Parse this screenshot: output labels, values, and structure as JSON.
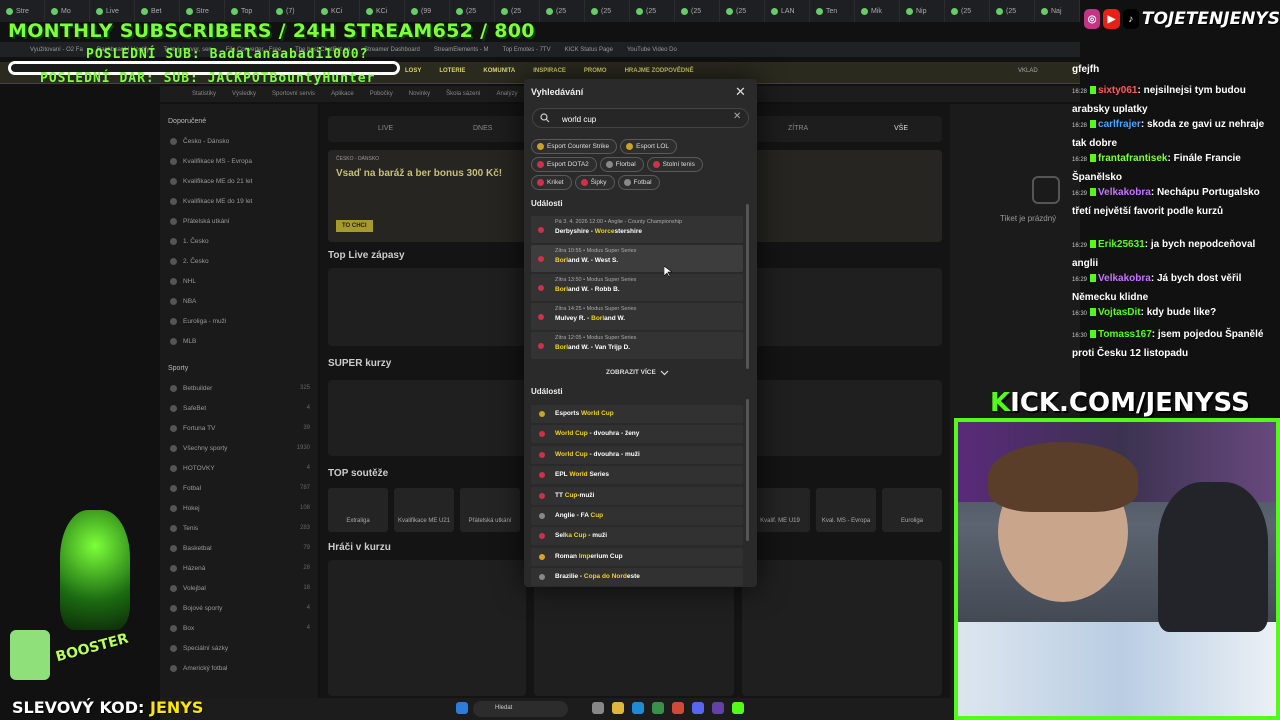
{
  "browser": {
    "tabs": [
      "Stre",
      "Mo",
      "Live",
      "Bet",
      "Stre",
      "Top",
      "(7)",
      "KCi",
      "KCi",
      "(99",
      "(25",
      "(25",
      "(25",
      "(25",
      "(25",
      "(25",
      "(25",
      "LAN",
      "Ten",
      "Mik",
      "Nip",
      "(25",
      "(25",
      "Naj",
      "(25",
      "(25"
    ],
    "bookmarks": [
      "Využitovaní - O2 Fa",
      "Dashboard | Hostify",
      "Tentyj. server, sen",
      "File Converter - Free",
      "The best ChatBot an",
      "Streamer Dashboard",
      "StreamElements - M",
      "Top Emotes - 7TV",
      "KICK Status Page",
      "YouTube Video Do"
    ]
  },
  "overlay": {
    "title": "MONTHLY SUBSCRIBERS / 24H STREAM652 / 800",
    "last_sub": "POSLEDNÍ SUB: Badalanaabadi1000?",
    "last_donation": "POSLEDNÍ DAR: SUB: JACKPOTBountyHunter",
    "handle": "TOJETENJENYS",
    "kick_prefix": "K",
    "kick_rest": "ICK.COM/JENYSS",
    "promo_label": "SLEVOVÝ KOD:",
    "promo_code": "JENYS",
    "booster_text": "BOOSTER"
  },
  "site": {
    "nav": [
      "LOSY",
      "LOTERIE",
      "KOMUNITA",
      "INSPIRACE",
      "PROMO",
      "HRAJME ZODPOVĚDNĚ"
    ],
    "login": "VKLAD",
    "subnav": [
      "Statistiky",
      "Výsledky",
      "Sportovní servis",
      "Aplikace",
      "Pobočky",
      "Novinky",
      "Škola sázení",
      "Analýzy"
    ],
    "sidebar_head_fav": "Doporučené",
    "sidebar_fav": [
      {
        "label": "Česko - Dánsko",
        "count": ""
      },
      {
        "label": "Kvalifikace MS - Evropa",
        "count": ""
      },
      {
        "label": "Kvalifikace ME do 21 let",
        "count": ""
      },
      {
        "label": "Kvalifikace ME do 19 let",
        "count": ""
      },
      {
        "label": "Přátelská utkání",
        "count": ""
      },
      {
        "label": "1. Česko",
        "count": ""
      },
      {
        "label": "2. Česko",
        "count": ""
      },
      {
        "label": "NHL",
        "count": ""
      },
      {
        "label": "NBA",
        "count": ""
      },
      {
        "label": "Euroliga - muži",
        "count": ""
      },
      {
        "label": "MLB",
        "count": ""
      }
    ],
    "sidebar_head_sport": "Sporty",
    "sidebar_sport": [
      {
        "label": "Betbuilder",
        "count": "325"
      },
      {
        "label": "SafeBet",
        "count": "4"
      },
      {
        "label": "Fortuna TV",
        "count": "39"
      },
      {
        "label": "Všechny sporty",
        "count": "1930"
      },
      {
        "label": "HOTOVKY",
        "count": "4"
      },
      {
        "label": "Fotbal",
        "count": "787"
      },
      {
        "label": "Hokej",
        "count": "108"
      },
      {
        "label": "Tenis",
        "count": "283"
      },
      {
        "label": "Basketbal",
        "count": "79"
      },
      {
        "label": "Házená",
        "count": "28"
      },
      {
        "label": "Volejbal",
        "count": "18"
      },
      {
        "label": "Bojové sporty",
        "count": "4"
      },
      {
        "label": "Box",
        "count": "4"
      },
      {
        "label": "Speciální sázky",
        "count": ""
      },
      {
        "label": "Americký fotbal",
        "count": ""
      }
    ],
    "tabs": [
      "LIVE",
      "DNES",
      "ZÍTRA",
      "VŠE"
    ],
    "promo_text": "Vsaď na baráž a ber bonus 300 Kč!",
    "promo_btn": "TO CHCI",
    "promo_country": "ČESKO - DÁNSKO",
    "section_live": "Top Live zápasy",
    "section_super": "SUPER kurzy",
    "section_top": "TOP soutěže",
    "section_players": "Hráči v kurzu",
    "tiles": [
      "Extraliga",
      "Kvalifikace ME U21",
      "Přátelská utkání",
      "Kvalif. ME U19",
      "Kval. MS - Evropa",
      "Euroliga"
    ],
    "ticket_empty": "Tiket je prázdný"
  },
  "search": {
    "title": "Vyhledávání",
    "query": "world cup",
    "chips": [
      {
        "label": "Esport Counter Strike",
        "color": "#c9a227"
      },
      {
        "label": "Esport LOL",
        "color": "#c9a227"
      },
      {
        "label": "Esport DOTA2",
        "color": "#d0304a"
      },
      {
        "label": "Florbal",
        "color": "#888888"
      },
      {
        "label": "Stolní tenis",
        "color": "#d0304a"
      },
      {
        "label": "Kriket",
        "color": "#d0304a"
      },
      {
        "label": "Šipky",
        "color": "#d0304a"
      },
      {
        "label": "Fotbal",
        "color": "#888888"
      }
    ],
    "events_label": "Události",
    "events": [
      {
        "meta": "Pá 3. 4. 2026 12:00 • Anglie - County Championship",
        "pre": "Derbyshire - ",
        "hl": "Worce",
        "post": "stershire"
      },
      {
        "meta": "Zítra 10:55 • Modus Super Series",
        "pre": "",
        "hl": "Borl",
        "post": "and W. - West S."
      },
      {
        "meta": "Zítra 13:50 • Modus Super Series",
        "pre": "",
        "hl": "Borl",
        "post": "and W. - Robb B."
      },
      {
        "meta": "Zítra 14:25 • Modus Super Series",
        "pre": "Mulvey R. - ",
        "hl": "Borl",
        "post": "and W."
      },
      {
        "meta": "Zítra 12:05 • Modus Super Series",
        "pre": "",
        "hl": "Borl",
        "post": "and W. - Van Trijp D."
      }
    ],
    "show_more": "ZOBRAZIT VÍCE",
    "results_label": "Události",
    "results": [
      {
        "pre": "Esports ",
        "hl": "World Cup",
        "post": ""
      },
      {
        "pre": "",
        "hl": "World Cup",
        "post": " - dvouhra - ženy"
      },
      {
        "pre": "",
        "hl": "World Cup",
        "post": " - dvouhra - muži"
      },
      {
        "pre": "EPL ",
        "hl": "World",
        "post": " Series"
      },
      {
        "pre": "TT ",
        "hl": "Cup",
        "post": "-muži"
      },
      {
        "pre": "Anglie - FA ",
        "hl": "Cup",
        "post": ""
      },
      {
        "pre": "Sel",
        "hl": "ka Cup",
        "post": " - muži"
      },
      {
        "pre": "Roman ",
        "hl": "Imp",
        "post": "erium Cup"
      },
      {
        "pre": "Brazilie - ",
        "hl": "Copa do Nord",
        "post": "este"
      }
    ]
  },
  "chat": {
    "user": "gfejfh",
    "messages": [
      {
        "ts": "16:28",
        "user": "sixty061",
        "ucolor": "#ff5a5a",
        "text": "nejsilnejsi tym budou arabsky uplatky"
      },
      {
        "ts": "16:28",
        "user": "carlfrajer",
        "ucolor": "#4aa3ff",
        "text": "skoda ze gavi uz nehraje tak dobre"
      },
      {
        "ts": "16:28",
        "user": "frantafrantisek",
        "ucolor": "#7dff3a",
        "text": "Finále Francie Španělsko"
      },
      {
        "ts": "16:29",
        "user": "Velkakobra",
        "ucolor": "#c873ff",
        "text": "Nechápu Portugalsko třetí největší favorit podle kurzů"
      },
      {
        "ts": "16:29",
        "user": "Erik25631",
        "ucolor": "#53fc18",
        "text": "ja bych nepodceňoval anglii"
      },
      {
        "ts": "16:29",
        "user": "Velkakobra",
        "ucolor": "#c873ff",
        "text": "Já bych dost věřil Německu klidne"
      },
      {
        "ts": "16:30",
        "user": "VojtasDit",
        "ucolor": "#53fc18",
        "text": "kdy bude like?"
      },
      {
        "ts": "16:30",
        "user": "Tomass167",
        "ucolor": "#53fc18",
        "text": "jsem pojedou Španělé proti Česku 12 listopadu"
      }
    ]
  },
  "taskbar": {
    "search_placeholder": "Hledat"
  }
}
